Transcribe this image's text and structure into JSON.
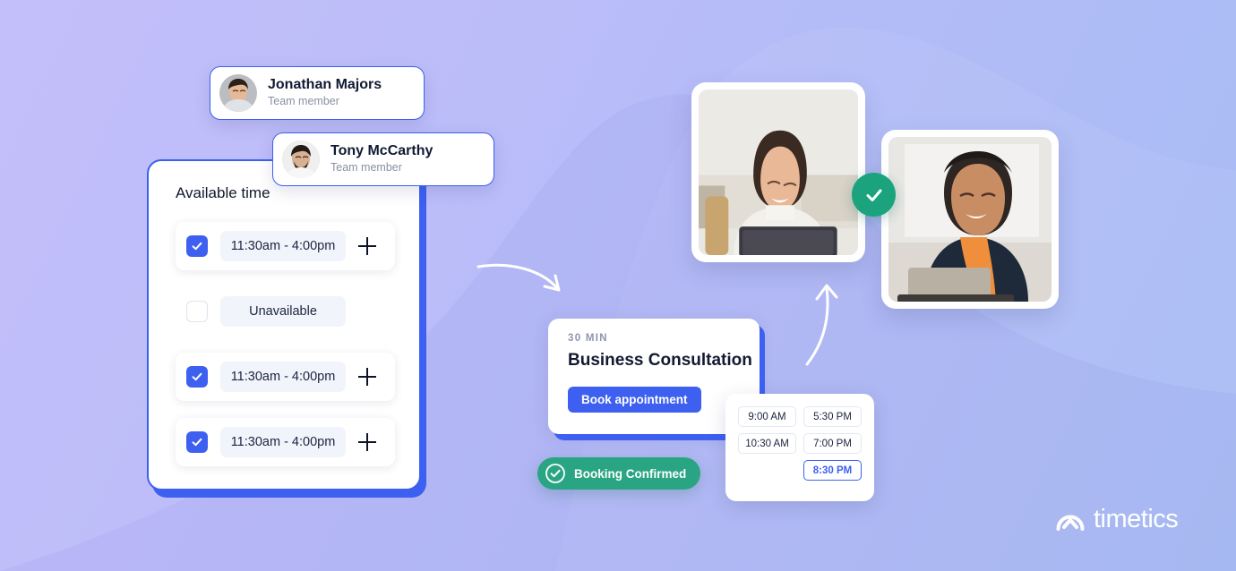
{
  "brand": {
    "name": "timetics",
    "logo_icon": "timetics-arch-chevron-icon",
    "accent_blue": "#3d60f0",
    "accent_green": "#1ba37e",
    "background_from": "#c3bffa",
    "background_to": "#a7bcf4"
  },
  "members": [
    {
      "name": "Jonathan Majors",
      "role": "Team member",
      "avatar_icon": "avatar-jonathan-majors"
    },
    {
      "name": "Tony McCarthy",
      "role": "Team member",
      "avatar_icon": "avatar-tony-mccarthy"
    }
  ],
  "availability": {
    "title": "Available time",
    "rows": [
      {
        "checked": true,
        "label": "11:30am - 4:00pm",
        "add_icon": "plus-icon",
        "has_add": true
      },
      {
        "checked": false,
        "label": "Unavailable",
        "add_icon": "plus-icon",
        "has_add": false
      },
      {
        "checked": true,
        "label": "11:30am - 4:00pm",
        "add_icon": "plus-icon",
        "has_add": true
      },
      {
        "checked": true,
        "label": "11:30am - 4:00pm",
        "add_icon": "plus-icon",
        "has_add": true
      }
    ],
    "check_icon": "checkmark-icon"
  },
  "consultation": {
    "duration": "30 MIN",
    "title": "Business Consultation",
    "book_label": "Book appointment"
  },
  "slot_picker": {
    "slots": [
      {
        "label": "9:00 AM",
        "selected": false
      },
      {
        "label": "5:30 PM",
        "selected": false
      },
      {
        "label": "10:30 AM",
        "selected": false
      },
      {
        "label": "7:00 PM",
        "selected": false
      },
      {
        "label": "",
        "selected": false,
        "empty": true
      },
      {
        "label": "8:30 PM",
        "selected": true
      }
    ]
  },
  "confirmation": {
    "label": "Booking Confirmed",
    "icon": "check-circle-icon"
  },
  "media": {
    "photo_left_alt": "woman-smiling-at-laptop-photo",
    "photo_right_alt": "man-smiling-at-laptop-photo",
    "success_badge_icon": "check-icon"
  },
  "decoration": {
    "arrow_1": "curved-arrow-right-icon",
    "arrow_2": "curved-arrow-up-icon",
    "blob": "background-wave-blob"
  }
}
